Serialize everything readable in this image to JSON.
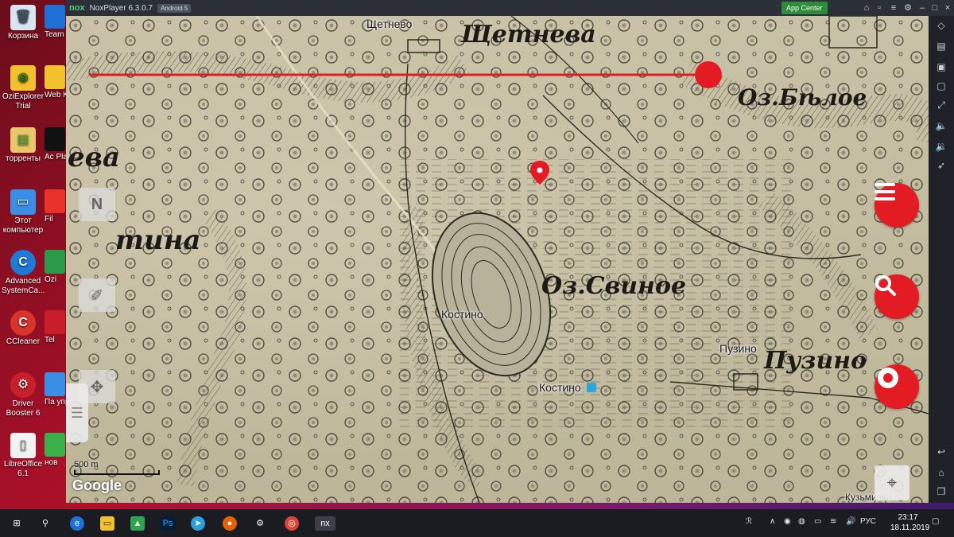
{
  "desktop": {
    "icons": [
      {
        "label": "Корзина",
        "icon": "recycle-bin-icon",
        "color": "#d9e6f2"
      },
      {
        "label": "OziExplorer Trial",
        "icon": "oziexplorer-icon",
        "color": "#f2c12e"
      },
      {
        "label": "торренты",
        "icon": "folder-icon",
        "color": "#e8c76a"
      },
      {
        "label": "Этот компьютер",
        "icon": "computer-icon",
        "color": "#3a8ee6"
      },
      {
        "label": "Advanced SystemCa...",
        "icon": "advanced-systemcare-icon",
        "color": "#1e7ad6"
      },
      {
        "label": "CCleaner",
        "icon": "ccleaner-icon",
        "color": "#d9342b"
      },
      {
        "label": "Driver Booster 6",
        "icon": "driver-booster-icon",
        "color": "#c8202a"
      },
      {
        "label": "LibreOffice 6.1",
        "icon": "libreoffice-icon",
        "color": "#f2f2f2"
      }
    ],
    "col2": [
      "Team",
      "Web Keep",
      "Ac Pla",
      "Fil",
      "Ozi",
      "Tel",
      "Па упра",
      "нов"
    ]
  },
  "emulator": {
    "brand": "nox",
    "version": "NoxPlayer 6.3.0.7",
    "android": "Android 5",
    "app_center": "App Center"
  },
  "map": {
    "labels": {
      "shchetnevo": "Щетнево",
      "kostino": "Костино",
      "kostino2": "Костино",
      "puzino": "Пузино",
      "kuzminki": "Кузьминки"
    },
    "old_labels": {
      "shchetneva": "Щетнева",
      "oz_beloe": "Оз.Бѣлое",
      "oz_svinoe": "Оз.Свиное",
      "tina": "тина",
      "eva": "ева",
      "puzino_old": "Пузино"
    },
    "compass_label": "N",
    "scale_label": "500 m",
    "google_label": "Google",
    "accent": "#e31b23"
  },
  "taskbar": {
    "lang": "РУС",
    "time": "23:17",
    "date": "18.11.2019"
  }
}
